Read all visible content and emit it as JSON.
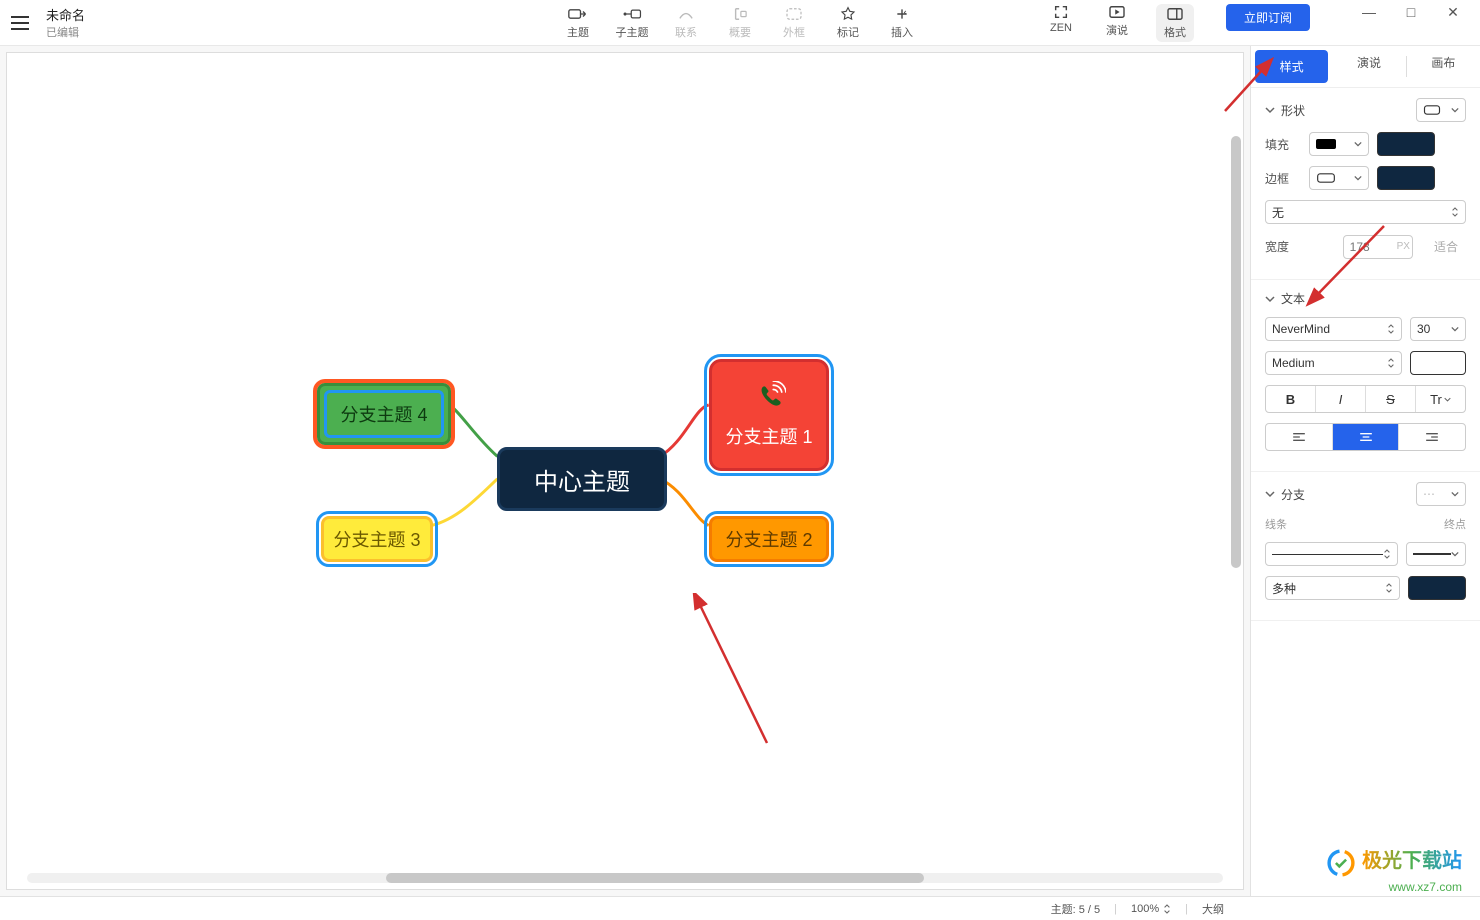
{
  "window": {
    "title": "未命名",
    "subtitle": "已编辑",
    "minimize": "—",
    "maximize": "□",
    "close": "✕"
  },
  "toolbar": {
    "main_topic": "主题",
    "sub_topic": "子主题",
    "relation": "联系",
    "summary": "概要",
    "boundary": "外框",
    "marker": "标记",
    "insert": "插入",
    "zen": "ZEN",
    "present": "演说",
    "format": "格式",
    "subscribe": "立即订阅"
  },
  "mindmap": {
    "center": "中心主题",
    "branch1": "分支主题 1",
    "branch2": "分支主题 2",
    "branch3": "分支主题 3",
    "branch4": "分支主题 4"
  },
  "panel": {
    "tabs": {
      "style": "样式",
      "present": "演说",
      "canvas": "画布"
    },
    "shape_section": "形状",
    "fill": "填充",
    "border": "边框",
    "border_style": "无",
    "width": "宽度",
    "width_value": "178",
    "width_unit": "PX",
    "fit": "适合",
    "text_section": "文本",
    "font": "NeverMind",
    "font_size": "30",
    "font_weight": "Medium",
    "bold": "B",
    "italic": "I",
    "strike": "S",
    "text_case": "Tr",
    "branch_section": "分支",
    "line_label": "线条",
    "endpoint_label": "终点",
    "multi": "多种"
  },
  "statusbar": {
    "topic": "主题: 5 / 5",
    "zoom": "100%",
    "outline": "大纲"
  },
  "watermark": {
    "name": "极光下载站",
    "url": "www.xz7.com"
  }
}
